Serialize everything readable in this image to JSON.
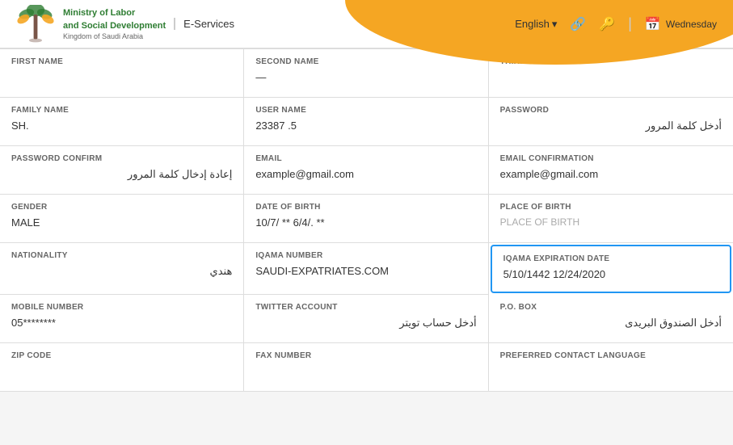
{
  "header": {
    "logo_text_line1": "Ministry of Labor",
    "logo_text_line2": "and Social Development",
    "logo_subtitle": "Kingdom of Saudi Arabia",
    "eservices_label": "E-Services",
    "lang_label": "English",
    "lang_arrow": "▾",
    "date_label": "Wednesday",
    "icon_link1": "🔗",
    "icon_link2": "🔑",
    "cal_icon": "📅"
  },
  "form": {
    "fields": [
      {
        "label": "FIRST NAME",
        "value": "",
        "placeholder": "",
        "row": 1
      },
      {
        "label": "SECOND NAME",
        "value": "—",
        "placeholder": "",
        "row": 1
      },
      {
        "label": "THIRD NAME",
        "value": "",
        "placeholder": "",
        "row": 1
      },
      {
        "label": "FAMILY NAME",
        "value": "SH.",
        "placeholder": "",
        "row": 2
      },
      {
        "label": "USER NAME",
        "value": "23387      .5",
        "placeholder": "",
        "row": 2
      },
      {
        "label": "PASSWORD",
        "value": "أدخل كلمة المرور",
        "placeholder": "",
        "is_arabic": true,
        "row": 2
      },
      {
        "label": "PASSWORD CONFIRM",
        "value": "إعادة إدخال كلمة المرور",
        "placeholder": "",
        "is_arabic": true,
        "row": 3
      },
      {
        "label": "EMAIL",
        "value": "example@gmail.com",
        "placeholder": "",
        "row": 3
      },
      {
        "label": "EMAIL CONFIRMATION",
        "value": "example@gmail.com",
        "placeholder": "",
        "row": 3
      },
      {
        "label": "GENDER",
        "value": "MALE",
        "placeholder": "",
        "row": 4
      },
      {
        "label": "DATE OF BIRTH",
        "value": "10/7/      ** 6/4/.   **",
        "placeholder": "",
        "row": 4
      },
      {
        "label": "PLACE OF BIRTH",
        "value": "",
        "placeholder": "PLACE OF BIRTH",
        "row": 4
      },
      {
        "label": "NATIONALITY",
        "value": "هندي",
        "placeholder": "",
        "is_arabic": true,
        "row": 5
      },
      {
        "label": "IQAMA NUMBER",
        "value": "SAUDI-EXPATRIATES.COM",
        "placeholder": "",
        "row": 5
      },
      {
        "label": "IQAMA EXPIRATION DATE",
        "value": "5/10/1442  12/24/2020",
        "placeholder": "",
        "highlighted": true,
        "row": 5
      },
      {
        "label": "MOBILE NUMBER",
        "value": "05********",
        "placeholder": "",
        "row": 6
      },
      {
        "label": "TWITTER ACCOUNT",
        "value": "أدخل حساب تويتر",
        "placeholder": "",
        "is_arabic": true,
        "row": 6
      },
      {
        "label": "P.O. BOX",
        "value": "أدخل الصندوق البريدى",
        "placeholder": "",
        "is_arabic": true,
        "row": 6
      },
      {
        "label": "ZIP CODE",
        "value": "",
        "placeholder": "",
        "row": 7
      },
      {
        "label": "FAX NUMBER",
        "value": "",
        "placeholder": "",
        "row": 7
      },
      {
        "label": "Preferred contact language",
        "value": "",
        "placeholder": "",
        "row": 7
      }
    ]
  }
}
